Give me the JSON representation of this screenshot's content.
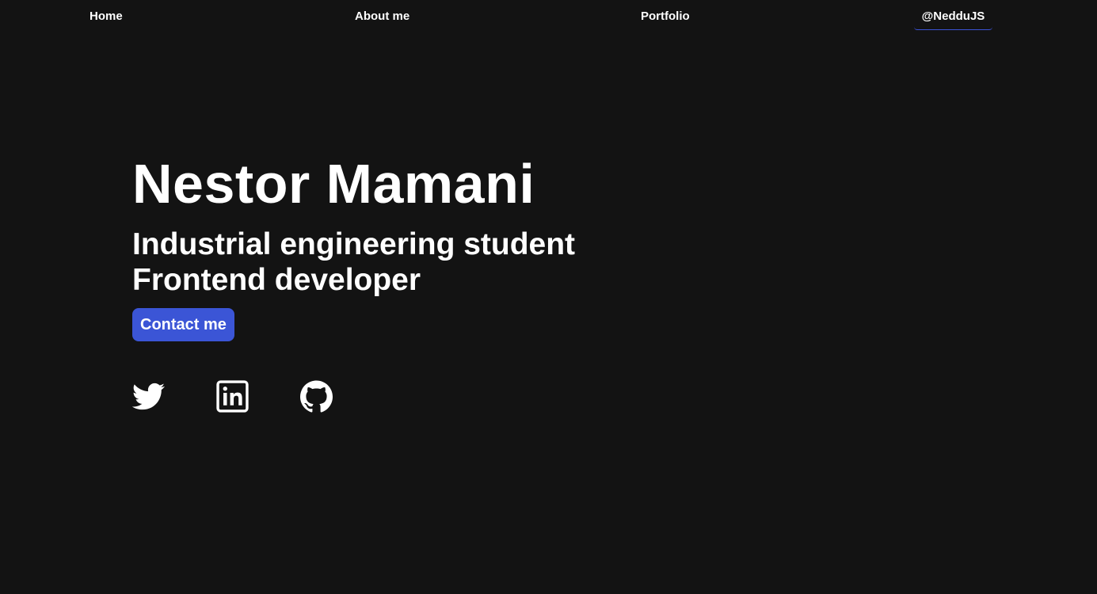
{
  "nav": {
    "home": "Home",
    "about": "About me",
    "portfolio": "Portfolio",
    "handle": "@NedduJS"
  },
  "hero": {
    "name": "Nestor Mamani",
    "roles": [
      "Industrial engineering student",
      "Frontend developer"
    ],
    "contact_label": "Contact me"
  },
  "socials": [
    {
      "icon": "twitter-icon"
    },
    {
      "icon": "linkedin-icon"
    },
    {
      "icon": "github-icon"
    }
  ],
  "colors": {
    "background": "#131313",
    "text": "#ffffff",
    "accent": "#3b55d6"
  }
}
